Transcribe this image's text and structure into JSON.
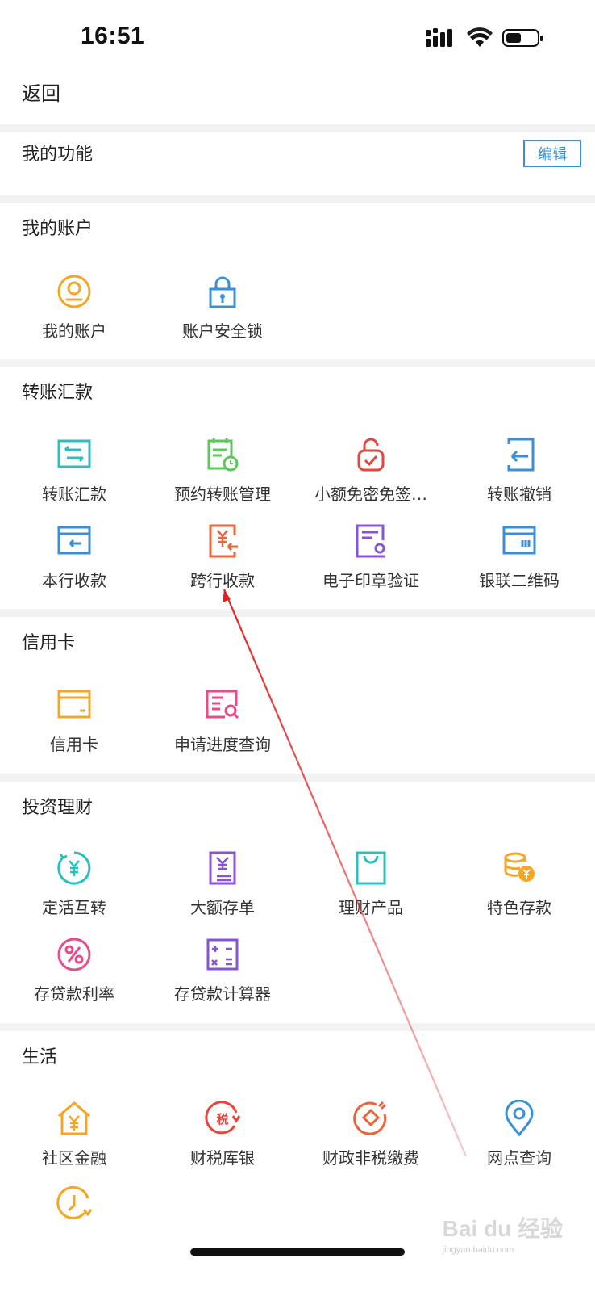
{
  "status_bar": {
    "time": "16:51"
  },
  "nav": {
    "back_label": "返回"
  },
  "sections": {
    "my_functions": {
      "title": "我的功能",
      "edit_label": "编辑"
    },
    "my_account": {
      "title": "我的账户",
      "items": [
        "我的账户",
        "账户安全锁"
      ]
    },
    "transfer": {
      "title": "转账汇款",
      "items": [
        "转账汇款",
        "预约转账管理",
        "小额免密免签…",
        "转账撤销",
        "本行收款",
        "跨行收款",
        "电子印章验证",
        "银联二维码"
      ]
    },
    "credit_card": {
      "title": "信用卡",
      "items": [
        "信用卡",
        "申请进度查询"
      ]
    },
    "investment": {
      "title": "投资理财",
      "items": [
        "定活互转",
        "大额存单",
        "理财产品",
        "特色存款",
        "存贷款利率",
        "存贷款计算器"
      ]
    },
    "life": {
      "title": "生活",
      "items": [
        "社区金融",
        "财税库银",
        "财政非税缴费",
        "网点查询"
      ]
    }
  },
  "watermark": {
    "text": "Bai du 经验",
    "sub": "jingyan.baidu.com"
  },
  "colors": {
    "accent": "#3a8fd6",
    "annotation_arrow": "#e02020"
  }
}
